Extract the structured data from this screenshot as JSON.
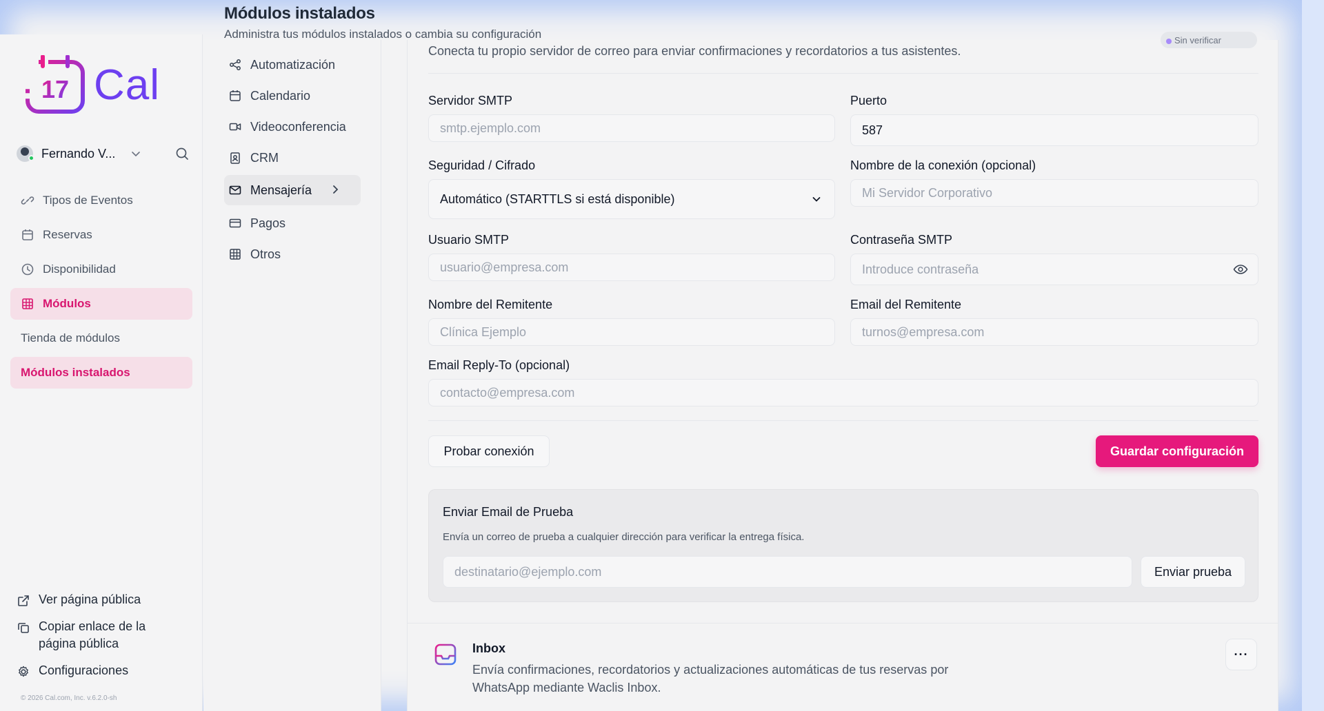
{
  "header": {
    "title": "Módulos instalados",
    "subtitle": "Administra tus módulos instalados o cambia su configuración"
  },
  "sidebar": {
    "logo_number": "17",
    "logo_text": "Cal",
    "user_name": "Fernando V...",
    "items": [
      {
        "label": "Tipos de Eventos",
        "icon": "link-icon"
      },
      {
        "label": "Reservas",
        "icon": "calendar-icon"
      },
      {
        "label": "Disponibilidad",
        "icon": "clock-icon"
      },
      {
        "label": "Módulos",
        "icon": "grid-icon"
      }
    ],
    "subitems": [
      {
        "label": "Tienda de módulos"
      },
      {
        "label": "Módulos instalados"
      }
    ],
    "bottom": {
      "public_page": "Ver página pública",
      "copy_link": "Copiar enlace de la página pública",
      "settings": "Configuraciones"
    },
    "copyright": "© 2026 Cal.com, Inc. v.6.2.0-sh"
  },
  "subnav": {
    "items": [
      {
        "label": "Automatización"
      },
      {
        "label": "Calendario"
      },
      {
        "label": "Videoconferencia"
      },
      {
        "label": "CRM"
      },
      {
        "label": "Mensajería"
      },
      {
        "label": "Pagos"
      },
      {
        "label": "Otros"
      }
    ]
  },
  "smtp": {
    "badge": "Sin verificar",
    "description": "Conecta tu propio servidor de correo para enviar confirmaciones y recordatorios a tus asistentes.",
    "server_label": "Servidor SMTP",
    "server_placeholder": "smtp.ejemplo.com",
    "port_label": "Puerto",
    "port_value": "587",
    "security_label": "Seguridad / Cifrado",
    "security_value": "Automático (STARTTLS si está disponible)",
    "conn_name_label": "Nombre de la conexión (opcional)",
    "conn_name_placeholder": "Mi Servidor Corporativo",
    "user_label": "Usuario SMTP",
    "user_placeholder": "usuario@empresa.com",
    "password_label": "Contraseña SMTP",
    "password_placeholder": "Introduce contraseña",
    "sender_name_label": "Nombre del Remitente",
    "sender_name_placeholder": "Clínica Ejemplo",
    "sender_email_label": "Email del Remitente",
    "sender_email_placeholder": "turnos@empresa.com",
    "reply_to_label": "Email Reply-To (opcional)",
    "reply_to_placeholder": "contacto@empresa.com",
    "test_connection": "Probar conexión",
    "save": "Guardar configuración"
  },
  "test_email": {
    "title": "Enviar Email de Prueba",
    "description": "Envía un correo de prueba a cualquier dirección para verificar la entrega física.",
    "placeholder": "destinatario@ejemplo.com",
    "button": "Enviar prueba"
  },
  "inbox": {
    "title": "Inbox",
    "description": "Envía confirmaciones, recordatorios y actualizaciones automáticas de tus reservas por WhatsApp mediante Waclis Inbox.",
    "more": "···"
  },
  "colors": {
    "accent": "#e6197c",
    "active_bg": "#f6dfe8",
    "brand_purple": "#6d3ff0"
  }
}
